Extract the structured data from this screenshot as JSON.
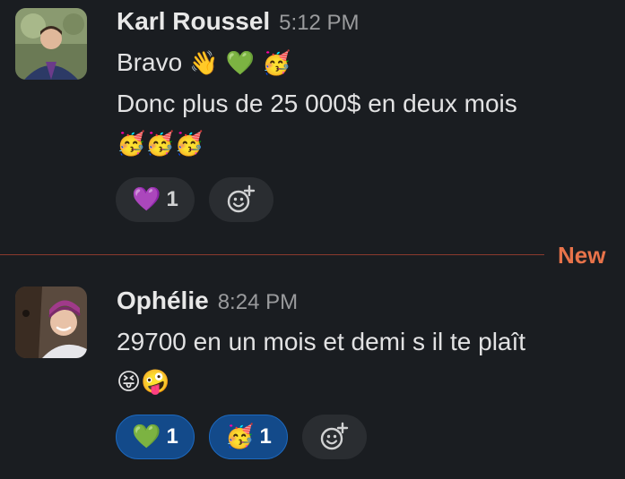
{
  "messages": [
    {
      "author": "Karl Roussel",
      "time": "5:12 PM",
      "lines": [
        "Bravo",
        "Donc plus de 25 000$ en deux mois"
      ],
      "line1_emoji": "👋 💚 🥳",
      "emoji_line": "🥳🥳🥳",
      "reactions": [
        {
          "emoji": "💜",
          "count": "1",
          "active": false
        }
      ]
    },
    {
      "author": "Ophélie",
      "time": "8:24 PM",
      "lines": [
        "29700 en un mois et demi s il te plaît"
      ],
      "emoji_line": "😝🤪",
      "reactions": [
        {
          "emoji": "💚",
          "count": "1",
          "active": true
        },
        {
          "emoji": "🥳",
          "count": "1",
          "active": true
        }
      ]
    }
  ],
  "divider": {
    "label": "New"
  },
  "colors": {
    "background": "#1a1d21",
    "new_accent": "#e8734a",
    "active_reaction": "#134a8a"
  }
}
